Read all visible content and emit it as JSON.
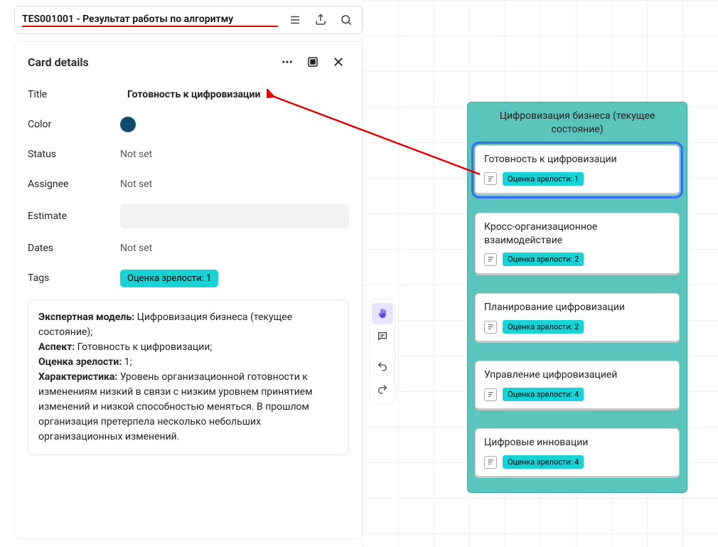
{
  "topbar": {
    "title": "TES001001 - Результат   работы по алгоритму  "
  },
  "panel": {
    "header": "Card details",
    "fields": {
      "title_label": "Title",
      "title_value": "Готовность к цифровизации",
      "color_label": "Color",
      "status_label": "Status",
      "status_value": "Not set",
      "assignee_label": "Assignee",
      "assignee_value": "Not set",
      "estimate_label": "Estimate",
      "estimate_value": "",
      "dates_label": "Dates",
      "dates_value": "Not set",
      "tags_label": "Tags",
      "tags_value": "Оценка зрелости: 1"
    },
    "description": {
      "l1b": "Экспертная модель:",
      "l1t": " Цифровизация бизнеса (текущее состояние);",
      "l2b": "Аспект:",
      "l2t": " Готовность к цифровизации;",
      "l3b": "Оценка зрелости:",
      "l3t": " 1;",
      "l4b": "Характеристика:",
      "l4t": " Уровень организационной готовности к изменениям низкий в связи с низким уровнем принятием изменений и низкой способностью меняться. В прошлом организация претерпела несколько небольших организационных изменений."
    }
  },
  "board": {
    "title": "Цифровизация бизнеса (текущее состояние)",
    "cards": [
      {
        "title": "Готовность к цифровизации",
        "tag": "Оценка зрелости: 1",
        "selected": true
      },
      {
        "title": "Кросс-организационное взаимодействие",
        "tag": "Оценка зрелости: 2",
        "selected": false
      },
      {
        "title": "Планирование цифровизации",
        "tag": "Оценка зрелости: 2",
        "selected": false
      },
      {
        "title": "Управление цифровизацией",
        "tag": "Оценка зрелости: 4",
        "selected": false
      },
      {
        "title": "Цифровые инновации",
        "tag": "Оценка зрелости: 4",
        "selected": false
      }
    ]
  }
}
